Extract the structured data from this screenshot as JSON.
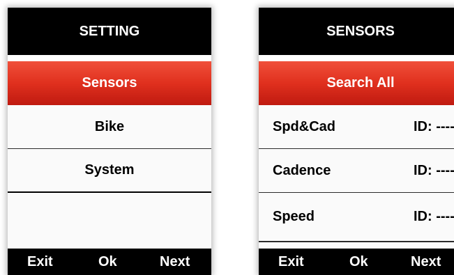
{
  "setting_screen": {
    "title": "SETTING",
    "items": [
      {
        "label": "Sensors"
      },
      {
        "label": "Bike"
      },
      {
        "label": "System"
      }
    ],
    "footer": {
      "left": "Exit",
      "center": "Ok",
      "right": "Next"
    }
  },
  "sensors_screen": {
    "title": "SENSORS",
    "search_label": "Search All",
    "sensors": [
      {
        "label": "Spd&Cad",
        "id": "ID: ----"
      },
      {
        "label": "Cadence",
        "id": "ID: ----"
      },
      {
        "label": "Speed",
        "id": "ID: ----"
      }
    ],
    "footer": {
      "left": "Exit",
      "center": "Ok",
      "right": "Next"
    }
  },
  "colors": {
    "selected_top": "#f0503a",
    "selected_bottom": "#bf1a10",
    "bar": "#000000"
  }
}
